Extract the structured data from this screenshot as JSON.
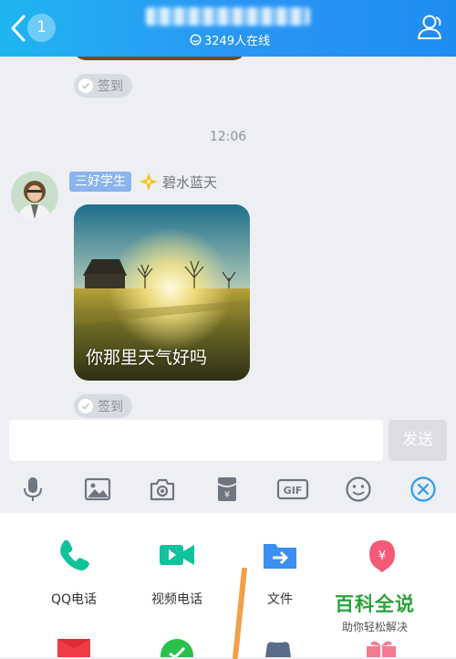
{
  "header": {
    "unread_count": "1",
    "online_text": "3249人在线"
  },
  "chat": {
    "signin_label": "签到",
    "timestamp": "12:06",
    "message": {
      "level_badge": "三好学生",
      "sender_name": "碧水蓝天",
      "caption": "你那里天气好吗"
    }
  },
  "composer": {
    "input_placeholder": "",
    "send_label": "发送"
  },
  "toolbar": {
    "icons": [
      "microphone-icon",
      "image-icon",
      "camera-icon",
      "red-packet-icon",
      "gif-icon",
      "emoji-icon",
      "close-panel-icon"
    ]
  },
  "panel": {
    "items": [
      {
        "label": "QQ电话",
        "icon": "phone-icon",
        "color": "#12c29b"
      },
      {
        "label": "视频电话",
        "icon": "video-camera-icon",
        "color": "#12c29b"
      },
      {
        "label": "文件",
        "icon": "file-transfer-icon",
        "color": "#3b8ff0"
      },
      {
        "label": "",
        "icon": "red-packet-yuan-icon",
        "color": "#f55a78"
      }
    ]
  },
  "watermark": {
    "title": "百科全说",
    "subtitle": "助你轻松解决"
  },
  "colors": {
    "header_accent": "#1fa5f2",
    "icon_gray": "#6f7680",
    "close_blue": "#2a9bf0"
  }
}
